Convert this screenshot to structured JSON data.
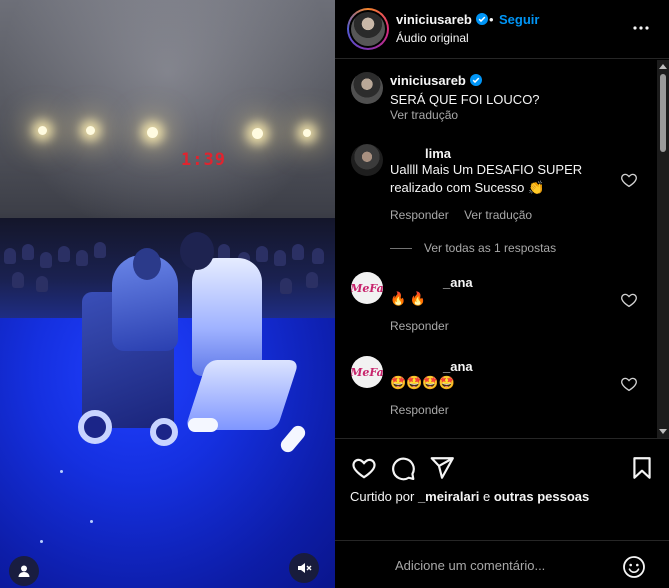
{
  "post": {
    "author": "viniciusareb",
    "dot": "•",
    "follow_label": "Seguir",
    "audio_label": "Áudio original",
    "media": {
      "stage_clock": "1:39"
    }
  },
  "caption": {
    "username": "viniciusareb",
    "text": "SERÁ QUE FOI LOUCO?",
    "translate_label": "Ver tradução"
  },
  "comments": [
    {
      "username": "lima",
      "text": "Uallll Mais Um DESAFIO SUPER realizado com Sucesso 👏",
      "reply_label": "Responder",
      "translate_label": "Ver tradução",
      "replies_label": "Ver todas as 1 respostas"
    },
    {
      "username": "_ana",
      "text": "🔥 🔥",
      "reply_label": "Responder"
    },
    {
      "username": "_ana",
      "text": "🤩🤩🤩🤩",
      "reply_label": "Responder"
    }
  ],
  "likes": {
    "prefix": "Curtido por",
    "user": "_meiralari",
    "conjunction": "e",
    "others": "outras pessoas"
  },
  "composer": {
    "placeholder": "Adicione um comentário..."
  },
  "icons": {
    "more": "more-horizontal-icon",
    "verified": "verified-badge-icon",
    "like": "heart-icon",
    "comment": "comment-icon",
    "share": "send-icon",
    "save": "bookmark-icon",
    "emoji": "emoji-icon",
    "mute": "muted-speaker-icon",
    "tags": "user-tag-icon"
  },
  "colors": {
    "link": "#0095f6",
    "verified": "#0095f6",
    "secondary_text": "#a8a8a8"
  }
}
